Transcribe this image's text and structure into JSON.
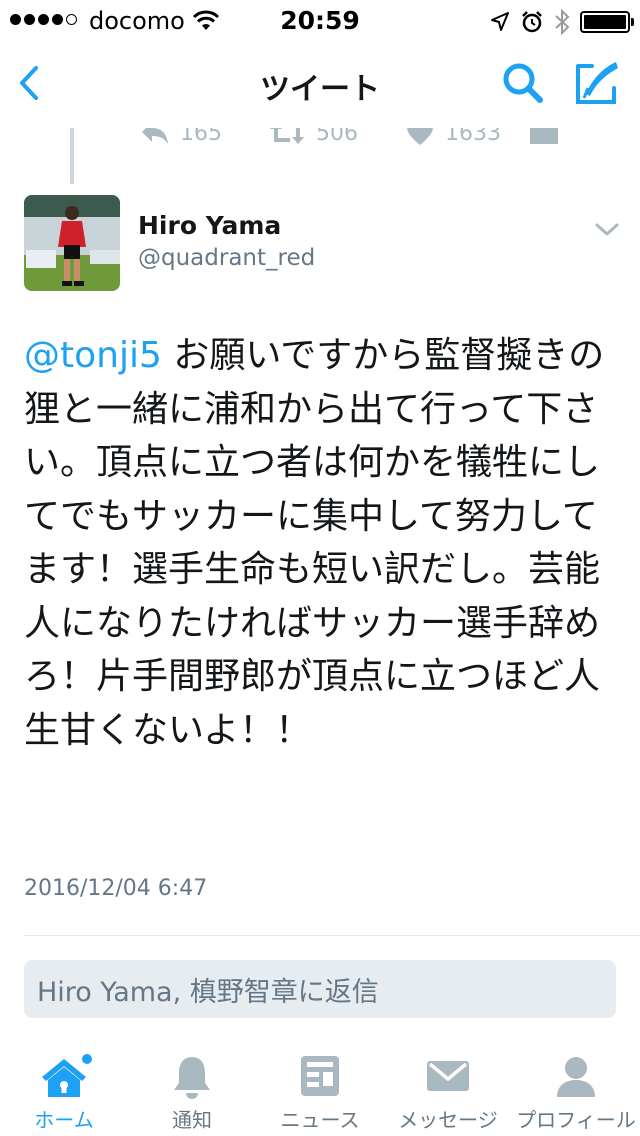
{
  "status_bar": {
    "carrier": "docomo",
    "time": "20:59"
  },
  "nav": {
    "title": "ツイート"
  },
  "previous_tweet": {
    "reply_count": "165",
    "retweet_count": "506",
    "like_count": "1633"
  },
  "tweet": {
    "display_name": "Hiro Yama",
    "username": "@quadrant_red",
    "mention": "@tonji5",
    "text": " お願いですから監督擬きの狸と一緒に浦和から出て行って下さい。頂点に立つ者は何かを犠牲にしてでもサッカーに集中して努力してます！選手生命も短い訳だし。芸能人になりたければサッカー選手辞めろ！片手間野郎が頂点に立つほど人生甘くないよ！！",
    "timestamp": "2016/12/04 6:47"
  },
  "reply": {
    "names": "Hiro Yama, 槙野智章",
    "suffix": " に返信"
  },
  "tabs": [
    {
      "label": "ホーム",
      "icon": "home-icon",
      "active": true
    },
    {
      "label": "通知",
      "icon": "bell-icon",
      "active": false
    },
    {
      "label": "ニュース",
      "icon": "news-icon",
      "active": false
    },
    {
      "label": "メッセージ",
      "icon": "envelope-icon",
      "active": false
    },
    {
      "label": "プロフィール",
      "icon": "person-icon",
      "active": false
    }
  ],
  "colors": {
    "accent": "#1da1f2",
    "text": "#14171a",
    "secondary": "#657786",
    "icon_gray": "#aab8c2"
  }
}
